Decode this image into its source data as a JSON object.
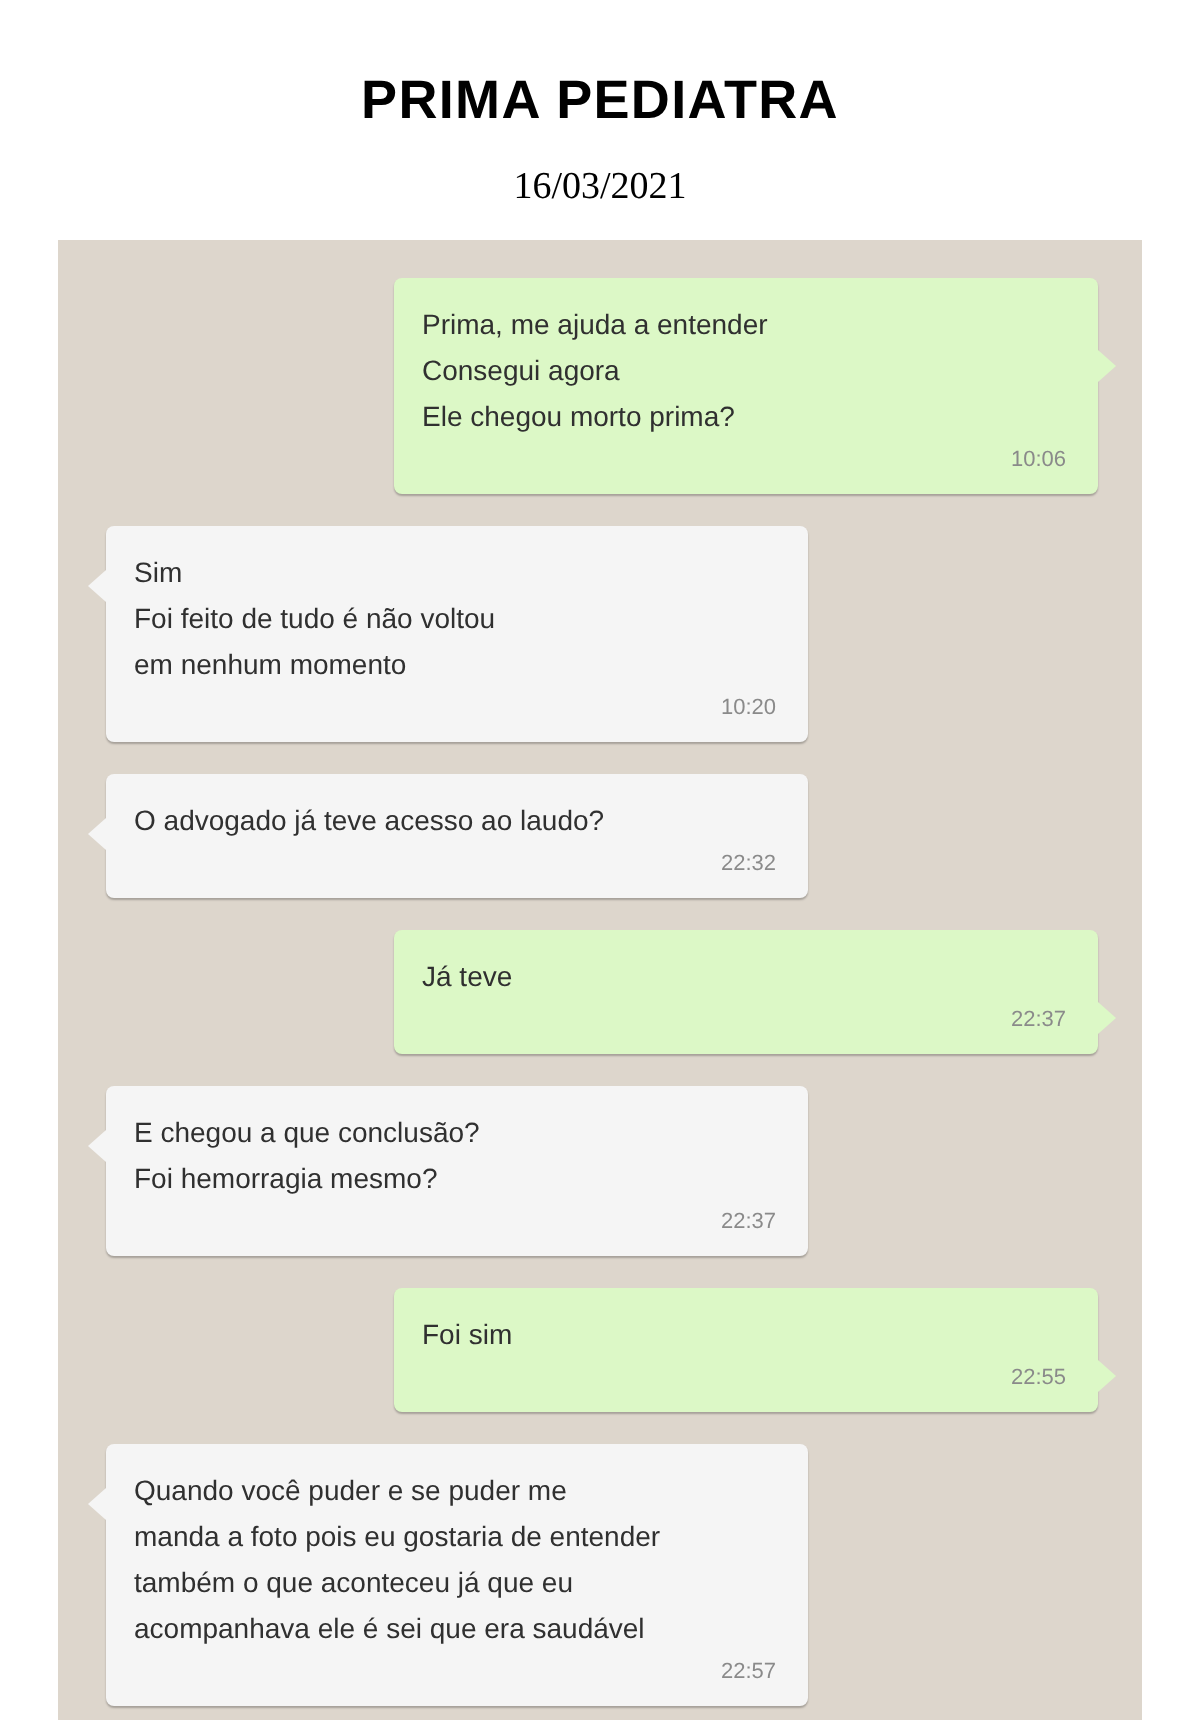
{
  "header": {
    "title": "PRIMA PEDIATRA",
    "date": "16/03/2021"
  },
  "messages": [
    {
      "outgoing": true,
      "text": "Prima, me ajuda a entender\nConsegui agora\nEle chegou morto prima?",
      "time": "10:06"
    },
    {
      "outgoing": false,
      "text": "Sim\nFoi feito de tudo é não voltou\nem nenhum momento",
      "time": "10:20"
    },
    {
      "outgoing": false,
      "text": "O advogado já teve acesso ao laudo?",
      "time": "22:32"
    },
    {
      "outgoing": true,
      "text": "Já teve",
      "time": "22:37"
    },
    {
      "outgoing": false,
      "text": "E chegou a que conclusão?\nFoi hemorragia mesmo?",
      "time": "22:37"
    },
    {
      "outgoing": true,
      "text": "Foi sim",
      "time": "22:55"
    },
    {
      "outgoing": false,
      "text": "Quando você puder e se puder me\nmanda a foto pois eu gostaria de entender\ntambém o que aconteceu já que eu\nacompanhava ele é sei que era saudável",
      "time": "22:57"
    }
  ]
}
